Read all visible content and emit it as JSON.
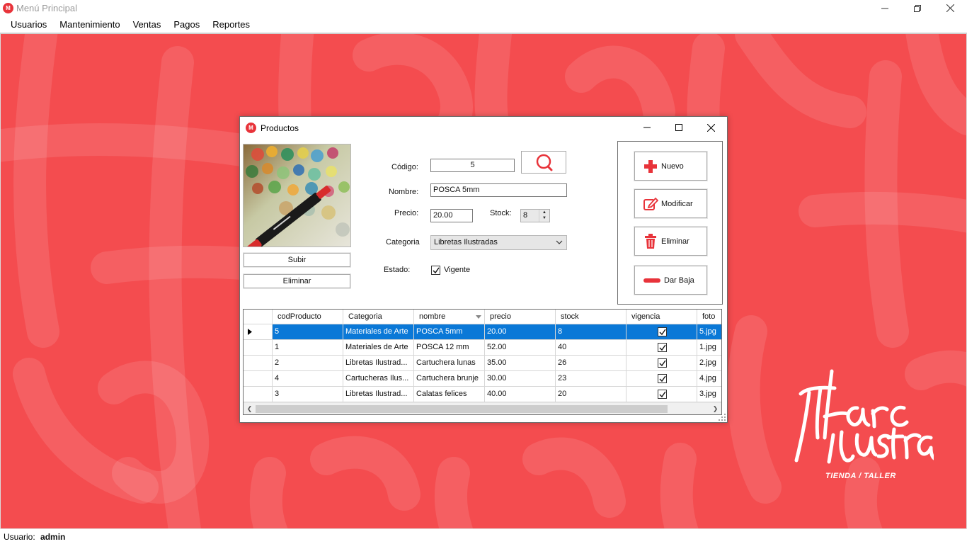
{
  "window": {
    "title": "Menú Principal",
    "icon_text": "M"
  },
  "menu": {
    "items": [
      "Usuarios",
      "Mantenimiento",
      "Ventas",
      "Pagos",
      "Reportes"
    ]
  },
  "logo": {
    "line1": "Marc",
    "line2": "ilustra",
    "tagline": "TIENDA / TALLER"
  },
  "status": {
    "label": "Usuario:",
    "user": "admin"
  },
  "dialog": {
    "title": "Productos",
    "photo_buttons": {
      "upload": "Subir",
      "delete": "Eliminar"
    },
    "form": {
      "codigo_label": "Código:",
      "codigo_value": "5",
      "nombre_label": "Nombre:",
      "nombre_value": "POSCA 5mm",
      "precio_label": "Precio:",
      "precio_value": "20.00",
      "stock_label": "Stock:",
      "stock_value": "8",
      "categoria_label": "Categoria",
      "categoria_value": "Libretas Ilustradas",
      "estado_label": "Estado:",
      "vigente_label": "Vigente",
      "vigente_checked": true
    },
    "actions": {
      "nuevo": "Nuevo",
      "modificar": "Modificar",
      "eliminar": "Eliminar",
      "dar_baja": "Dar Baja"
    },
    "grid": {
      "columns": [
        "codProducto",
        "Categoria",
        "nombre",
        "precio",
        "stock",
        "vigencia",
        "foto"
      ],
      "rows": [
        {
          "cod": "5",
          "categoria": "Materiales de Arte",
          "nombre": "POSCA 5mm",
          "precio": "20.00",
          "stock": "8",
          "vigencia": true,
          "foto": "5.jpg"
        },
        {
          "cod": "1",
          "categoria": "Materiales de Arte",
          "nombre": "POSCA 12 mm",
          "precio": "52.00",
          "stock": "40",
          "vigencia": true,
          "foto": "1.jpg"
        },
        {
          "cod": "2",
          "categoria": "Libretas Ilustrad...",
          "nombre": "Cartuchera lunas",
          "precio": "35.00",
          "stock": "26",
          "vigencia": true,
          "foto": "2.jpg"
        },
        {
          "cod": "4",
          "categoria": "Cartucheras Ilus...",
          "nombre": "Cartuchera brunje",
          "precio": "30.00",
          "stock": "23",
          "vigencia": true,
          "foto": "4.jpg"
        },
        {
          "cod": "3",
          "categoria": "Libretas Ilustrad...",
          "nombre": "Calatas felices",
          "precio": "40.00",
          "stock": "20",
          "vigencia": true,
          "foto": "3.jpg"
        }
      ],
      "selected_index": 0
    }
  },
  "colors": {
    "desktop": "#f44c4f",
    "accent": "#e8333a",
    "selection": "#0a78d7"
  }
}
